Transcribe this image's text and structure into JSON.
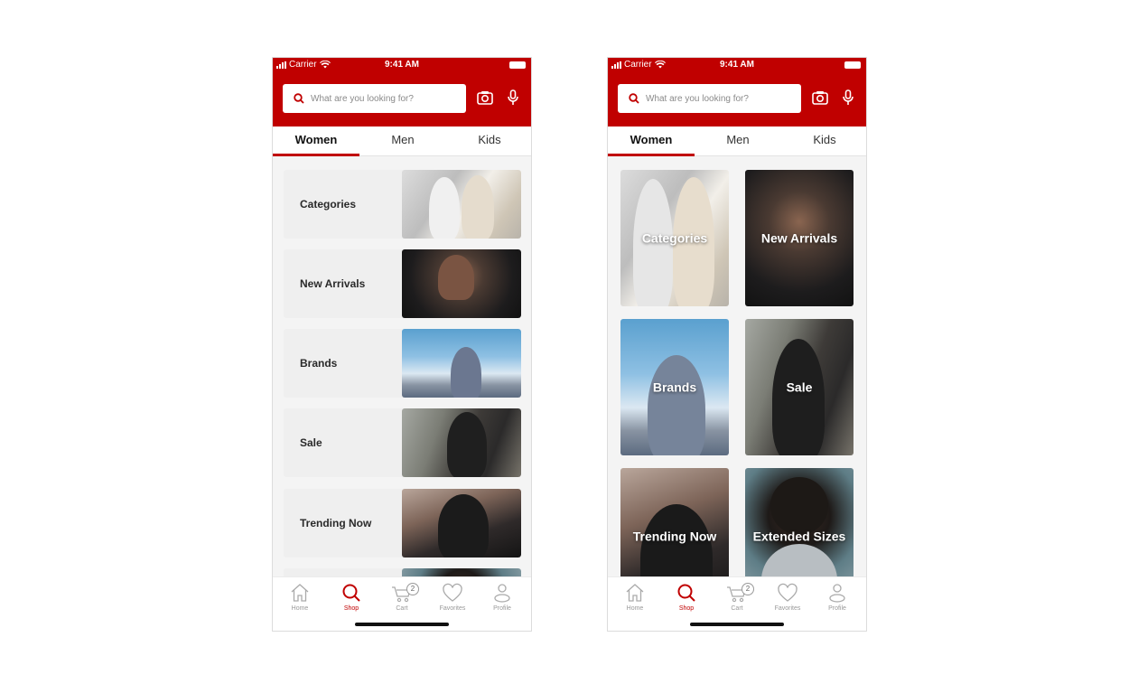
{
  "status_bar": {
    "carrier": "Carrier",
    "time": "9:41 AM"
  },
  "search": {
    "placeholder": "What are you looking for?"
  },
  "tabs": [
    {
      "label": "Women",
      "active": true
    },
    {
      "label": "Men",
      "active": false
    },
    {
      "label": "Kids",
      "active": false
    }
  ],
  "list_view": {
    "cards": [
      {
        "label": "Categories"
      },
      {
        "label": "New Arrivals"
      },
      {
        "label": "Brands"
      },
      {
        "label": "Sale"
      },
      {
        "label": "Trending Now"
      }
    ]
  },
  "grid_view": {
    "cards": [
      {
        "label": "Categories"
      },
      {
        "label": "New Arrivals"
      },
      {
        "label": "Brands"
      },
      {
        "label": "Sale"
      },
      {
        "label": "Trending Now"
      },
      {
        "label": "Extended Sizes"
      }
    ]
  },
  "bottom_nav": {
    "items": [
      {
        "label": "Home",
        "icon": "home-icon",
        "active": false
      },
      {
        "label": "Shop",
        "icon": "search-icon",
        "active": true
      },
      {
        "label": "Cart",
        "icon": "cart-icon",
        "active": false,
        "badge": "2"
      },
      {
        "label": "Favorites",
        "icon": "heart-icon",
        "active": false
      },
      {
        "label": "Profile",
        "icon": "profile-icon",
        "active": false
      }
    ]
  },
  "colors": {
    "brand": "#c00000",
    "background": "#f4f4f4",
    "card": "#efefef"
  }
}
